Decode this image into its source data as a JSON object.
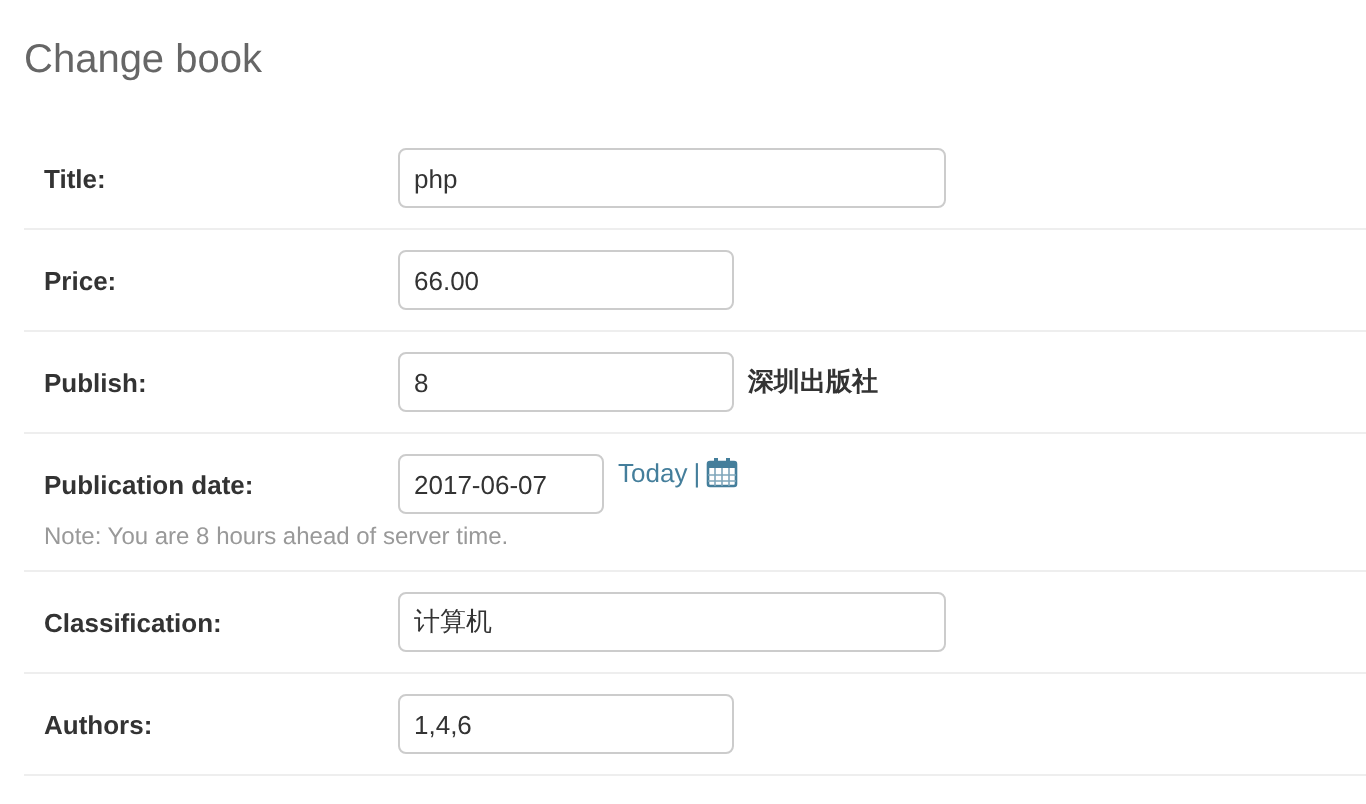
{
  "heading": "Change book",
  "fields": [
    {
      "label": "Title:",
      "value": "php",
      "kind": "wide"
    },
    {
      "label": "Price:",
      "value": "66.00",
      "kind": "short"
    },
    {
      "label": "Publish:",
      "value": "8",
      "kind": "short",
      "related": "深圳出版社"
    },
    {
      "label": "Publication date:",
      "value": "2017-06-07",
      "kind": "date",
      "today": "Today",
      "separator": "|",
      "note": "Note: You are 8 hours ahead of server time."
    },
    {
      "label": "Classification:",
      "value": "计算机",
      "kind": "wide"
    },
    {
      "label": "Authors:",
      "value": "1,4,6",
      "kind": "short"
    }
  ]
}
